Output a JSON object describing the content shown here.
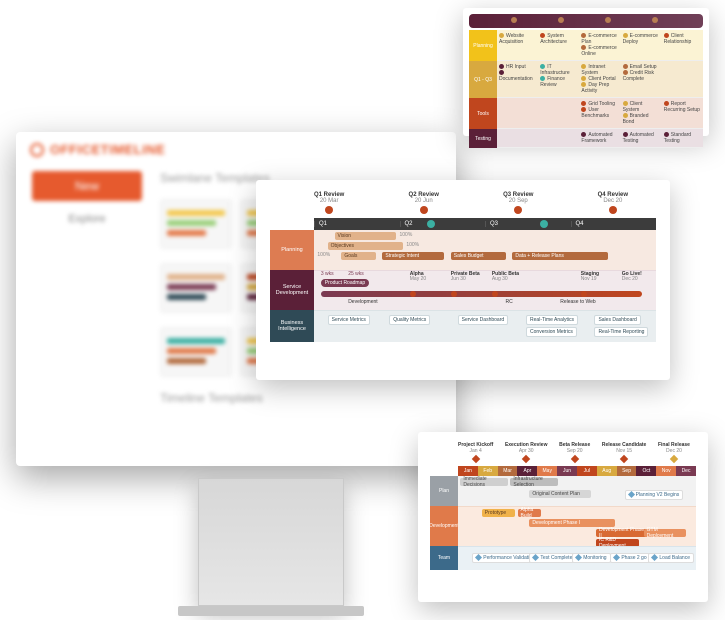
{
  "app": {
    "brand": "OFFICETIMELINE",
    "section1": "Swimlane Templates",
    "section2": "Timeline Templates",
    "new_label": "New",
    "side_item": "Explore"
  },
  "p1": {
    "rows": [
      {
        "label": "Planning",
        "items": [
          "Website Acquisition",
          "System Architecture",
          "E-commerce Plan",
          "E-commerce Online",
          "E-commerce Deploy",
          "Client Relationship"
        ]
      },
      {
        "label": "Q1 - Q3",
        "items": [
          "HR Input",
          "Documentation",
          "IT Infrastructure",
          "Finance Review",
          "Intranet System",
          "Client Portal",
          "Day Prep Activity",
          "Email Setup",
          "Credit Risk Complete"
        ]
      },
      {
        "label": "Tools",
        "items": [
          "",
          "",
          "Grid Tooling",
          "User Benchmarks",
          "Client System",
          "Branded Bond",
          "",
          "Report Recurring Setup"
        ]
      },
      {
        "label": "Testing",
        "items": [
          "",
          "",
          "Automated Framework",
          "Automated Testing",
          "",
          "Standard Testing"
        ]
      }
    ]
  },
  "p2": {
    "milestones": [
      {
        "title": "Q1 Review",
        "date": "20 Mar"
      },
      {
        "title": "Q2 Review",
        "date": "20 Jun"
      },
      {
        "title": "Q3 Review",
        "date": "20 Sep"
      },
      {
        "title": "Q4 Review",
        "date": "Dec 20"
      }
    ],
    "quarters": [
      "Q1",
      "Q2",
      "Q3",
      "Q4"
    ],
    "swimlanes": {
      "planning": {
        "label": "Planning",
        "bars": [
          {
            "label": "Vision",
            "pct": "100%"
          },
          {
            "label": "Objectives",
            "pct": "100%"
          },
          {
            "label": "Goals",
            "pct": "100%"
          },
          {
            "label": "Strategic Intent"
          },
          {
            "label": "Sales Budget"
          },
          {
            "label": "Data + Release Plans"
          }
        ]
      },
      "service_dev": {
        "label": "Service Development",
        "top_milestones": [
          {
            "label": "Alpha",
            "date": "May 20"
          },
          {
            "label": "Private Beta",
            "date": "Jun 30"
          },
          {
            "label": "Public Beta",
            "date": "Aug 30"
          },
          {
            "label": "Staging",
            "date": "Nov 19"
          },
          {
            "label": "Go Live!",
            "date": "Dec 20"
          }
        ],
        "span": {
          "from": "3 wks",
          "to": "25 wks",
          "label": "Product Roadmap"
        },
        "phases": [
          "Development",
          "",
          "RC",
          "Release to Web"
        ]
      },
      "bi": {
        "label": "Business Intelligence",
        "chips": [
          "Service Metrics",
          "Quality Metrics",
          "Service Dashboard",
          "Real-Time Analytics",
          "Sales Dashboard",
          "Conversion Metrics",
          "Real-Time Reporting"
        ]
      }
    }
  },
  "p3": {
    "top_milestones": [
      {
        "title": "Project Kickoff",
        "date": "Jan 4"
      },
      {
        "title": "Execution Review",
        "date": "Apr 30"
      },
      {
        "title": "Beta Release",
        "date": "Sep 20"
      },
      {
        "title": "Release Candidate",
        "date": "Nov 15"
      },
      {
        "title": "Final Release",
        "date": "Dec 20"
      }
    ],
    "months": [
      "Jan",
      "Feb",
      "Mar",
      "Apr",
      "May",
      "Jun",
      "Jul",
      "Aug",
      "Sep",
      "Oct",
      "Nov",
      "Dec"
    ],
    "lanes": {
      "plan": {
        "label": "Plan",
        "bars": [
          "Immediate Decisions",
          "Infrastructure Selection",
          "Original Content Plan"
        ],
        "chips": [
          "Planning V2 Begins"
        ]
      },
      "dev": {
        "label": "Development",
        "bars": [
          "Prototype",
          "Alpha Build",
          "Development Phase I",
          "Development Phase II",
          "IC R&D Deployment",
          "GTM Deployment"
        ]
      },
      "test": {
        "label": "Team",
        "chips": [
          "Performance Validation",
          "Test Complete",
          "Monitoring",
          "Phase 2 go",
          "Load Balance"
        ]
      }
    }
  }
}
